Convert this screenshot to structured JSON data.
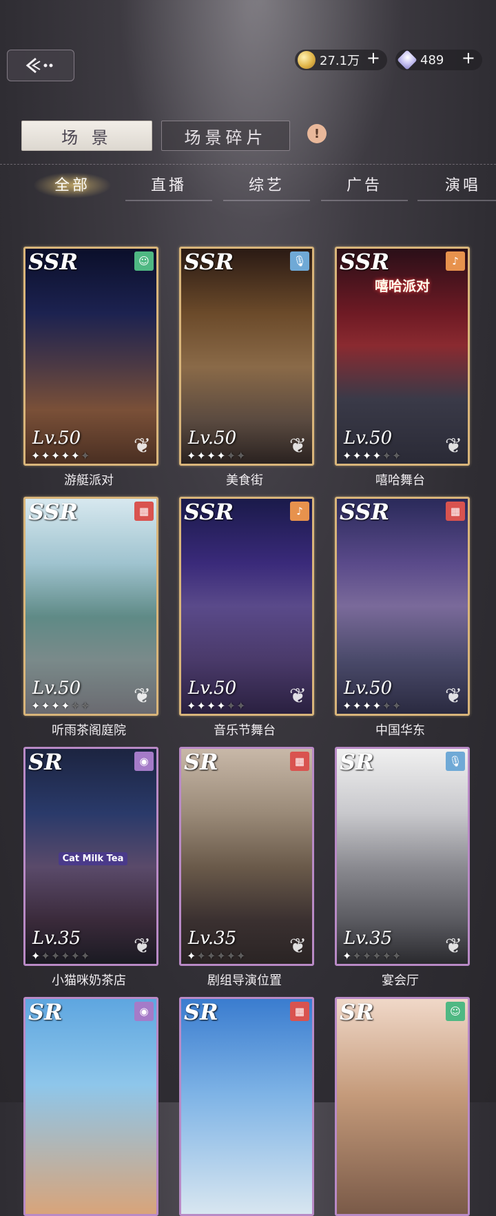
{
  "currency": {
    "gold": "27.1万",
    "diamond": "489",
    "plus": "+"
  },
  "tabs": [
    "场 景",
    "场景碎片"
  ],
  "alert_icon": "!",
  "filters": [
    "全部",
    "直播",
    "综艺",
    "广告",
    "演唱"
  ],
  "cards": [
    {
      "rarity": "SSR",
      "level": "Lv.50",
      "name": "游艇派对",
      "badge": "face-icon",
      "badge_color": "#4fb883",
      "stars": 5
    },
    {
      "rarity": "SSR",
      "level": "Lv.50",
      "name": "美食街",
      "badge": "microphone-icon",
      "badge_color": "#6fa9d6",
      "stars": 4
    },
    {
      "rarity": "SSR",
      "level": "Lv.50",
      "name": "嘻哈舞台",
      "badge": "sing-icon",
      "badge_color": "#e7924d",
      "stars": 4
    },
    {
      "rarity": "SSR",
      "level": "Lv.50",
      "name": "听雨茶阁庭院",
      "badge": "clapper-icon",
      "badge_color": "#d9534f",
      "stars": 4
    },
    {
      "rarity": "SSR",
      "level": "Lv.50",
      "name": "音乐节舞台",
      "badge": "sing-icon",
      "badge_color": "#e7924d",
      "stars": 4
    },
    {
      "rarity": "SSR",
      "level": "Lv.50",
      "name": "中国华东",
      "badge": "clapper-icon",
      "badge_color": "#d9534f",
      "stars": 4
    },
    {
      "rarity": "SR",
      "level": "Lv.35",
      "name": "小猫咪奶茶店",
      "badge": "lens-icon",
      "badge_color": "#a57bc8",
      "stars": 1
    },
    {
      "rarity": "SR",
      "level": "Lv.35",
      "name": "剧组导演位置",
      "badge": "clapper-icon",
      "badge_color": "#d9534f",
      "stars": 1
    },
    {
      "rarity": "SR",
      "level": "Lv.35",
      "name": "宴会厅",
      "badge": "microphone-icon",
      "badge_color": "#6fa9d6",
      "stars": 1
    },
    {
      "rarity": "SR",
      "level": "",
      "name": "",
      "badge": "lens-icon",
      "badge_color": "#a57bc8",
      "stars": 0
    },
    {
      "rarity": "SR",
      "level": "",
      "name": "",
      "badge": "clapper-icon",
      "badge_color": "#d9534f",
      "stars": 0
    },
    {
      "rarity": "SR",
      "level": "",
      "name": "",
      "badge": "face-icon",
      "badge_color": "#4fb883",
      "stars": 0
    }
  ],
  "card_text": {
    "cat_milk_tea_sign": "Cat Milk Tea",
    "hiphop_sign": "嘻哈派对"
  }
}
